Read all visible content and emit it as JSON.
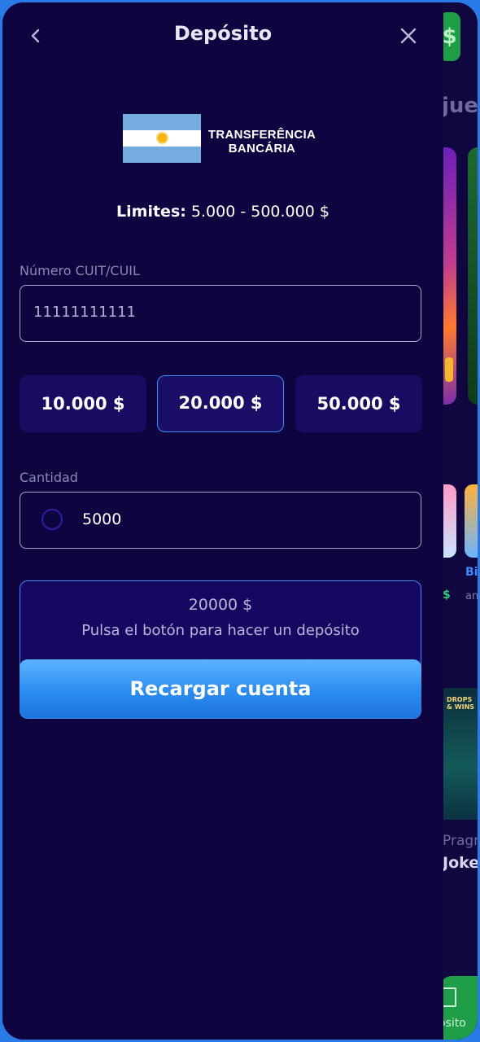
{
  "header": {
    "title": "Depósito",
    "back_icon": "chevron-left-icon",
    "close_icon": "close-icon"
  },
  "method": {
    "flag": "argentina-flag",
    "label_line1": "TRANSFERÊNCIA",
    "label_line2": "BANCÁRIA"
  },
  "limits": {
    "label": "Limites:",
    "value": "5.000 - 500.000 $"
  },
  "cuit_field": {
    "label": "Número CUIT/CUIL",
    "value": "11111111111"
  },
  "quick_amounts": [
    {
      "label": "10.000 $",
      "selected": false
    },
    {
      "label": "20.000 $",
      "selected": true
    },
    {
      "label": "50.000 $",
      "selected": false
    }
  ],
  "amount_field": {
    "label": "Cantidad",
    "value": "5000"
  },
  "summary": {
    "amount": "20000 $",
    "hint": "Pulsa el botón para hacer un depósito"
  },
  "cta": {
    "label": "Recargar cuenta"
  },
  "background_app": {
    "text_top": "jue",
    "text_pragmatic": "Pragr",
    "text_joker": "Joke",
    "text_bi": "Bi",
    "text_am": "an",
    "badge": "DROPS & WINS",
    "bottom_label": "ósito",
    "dollar": "$"
  },
  "colors": {
    "panel_bg": "#0e0540",
    "accent_blue": "#3b8cff",
    "cta_gradient_top": "#5db3ff",
    "cta_gradient_bottom": "#1f74dc",
    "chip_bg": "#180c62"
  }
}
